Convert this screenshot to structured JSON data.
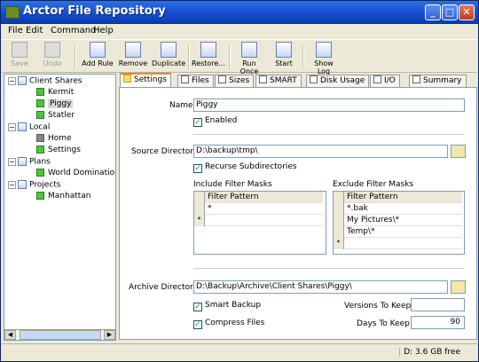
{
  "window": {
    "title": "Arctor File Repository"
  },
  "menu": [
    "File",
    "Edit",
    "Command",
    "Help"
  ],
  "toolbar": {
    "save": "Save",
    "undo": "Undo",
    "add_rule": "Add Rule",
    "remove": "Remove",
    "duplicate": "Duplicate",
    "restore": "Restore...",
    "run_once": "Run Once",
    "start": "Start",
    "show_log": "Show Log"
  },
  "tree": {
    "client_shares": "Client Shares",
    "kermit": "Kermit",
    "piggy": "Piggy",
    "statler": "Statler",
    "local": "Local",
    "home": "Home",
    "settings": "Settings",
    "plans": "Plans",
    "world_domination": "World Domination",
    "projects": "Projects",
    "manhattan": "Manhattan"
  },
  "tabs": [
    "Settings",
    "Files",
    "Sizes",
    "SMART",
    "Disk Usage",
    "I/O",
    "Summary"
  ],
  "settings": {
    "name_label": "Name",
    "name_value": "Piggy",
    "enabled": "Enabled",
    "source_label": "Source Directory",
    "source_value": "D:\\backup\\tmp\\",
    "recurse": "Recurse Subdirectories",
    "include_label": "Include Filter Masks",
    "exclude_label": "Exclude Filter Masks",
    "filter_header": "Filter Pattern",
    "include_rows": [
      "*"
    ],
    "exclude_rows": [
      "*.bak",
      "My Pictures\\*",
      "Temp\\*"
    ],
    "archive_label": "Archive Directory",
    "archive_value": "D:\\Backup\\Archive\\Client Shares\\Piggy\\",
    "smart_backup": "Smart Backup",
    "compress": "Compress Files",
    "versions_label": "Versions To Keep",
    "versions_value": "",
    "days_label": "Days To Keep",
    "days_value": "90"
  },
  "status": {
    "disk": "D:  3.6 GB free"
  }
}
